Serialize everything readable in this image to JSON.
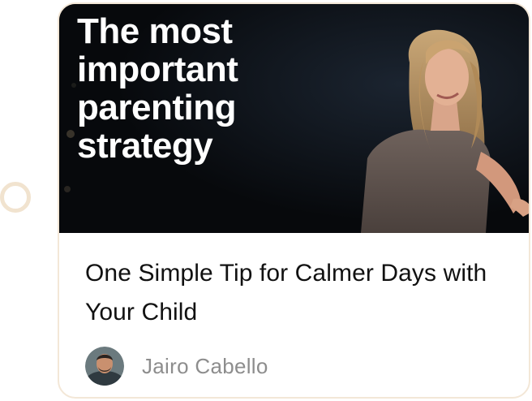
{
  "card": {
    "thumbnail_text": "The most important parenting strategy",
    "title": "One Simple Tip for Calmer Days with Your Child",
    "author": {
      "name": "Jairo Cabello",
      "avatar_icon": "person-avatar"
    }
  },
  "colors": {
    "timeline_dot": "#f1e3cf",
    "card_border": "#f3e7d7",
    "thumbnail_bg": "#0a0c10",
    "title_text": "#111111",
    "author_text": "#8d8d8d"
  }
}
